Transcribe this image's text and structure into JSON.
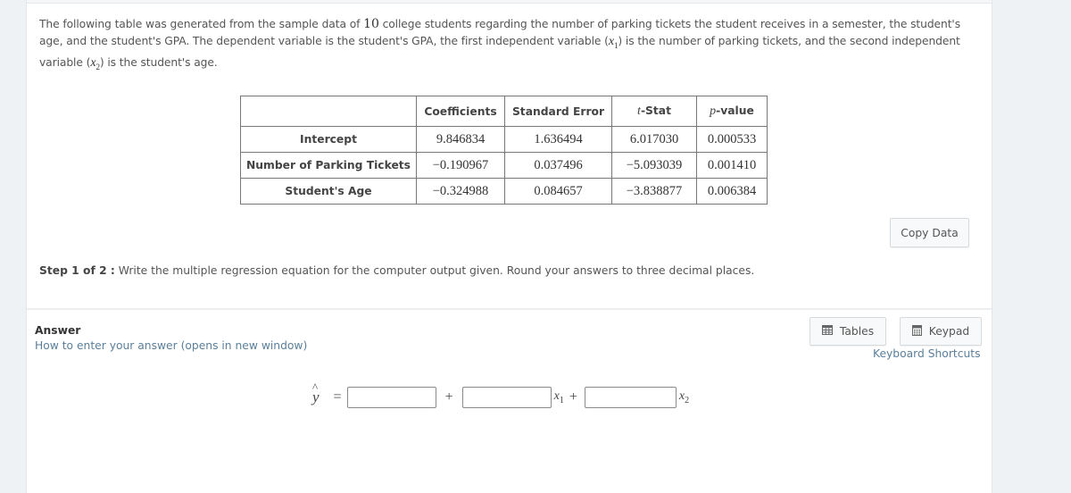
{
  "intro": {
    "part1": "The following table was generated from the sample data of ",
    "sample_size": "10",
    "part2": " college students regarding the number of parking tickets the student receives in a semester, the student's age, and the student's GPA. The dependent variable is the student's GPA, the first independent variable (",
    "x1_var": "x",
    "x1_sub": "1",
    "part3": ") is the number of parking tickets, and the second independent variable (",
    "x2_var": "x",
    "x2_sub": "2",
    "part4": ") is the student's age."
  },
  "table": {
    "headers": {
      "blank": "",
      "coefficients": "Coefficients",
      "standard_error": "Standard Error",
      "t_stat_italic": "t",
      "t_stat_rest": "-Stat",
      "p_value_italic": "p",
      "p_value_rest": "-value"
    },
    "rows": [
      {
        "label": "Intercept",
        "coefficient": "9.846834",
        "standard_error": "1.636494",
        "t_stat": "6.017030",
        "p_value": "0.000533"
      },
      {
        "label": "Number of Parking Tickets",
        "coefficient": "−0.190967",
        "standard_error": "0.037496",
        "t_stat": "−5.093039",
        "p_value": "0.001410"
      },
      {
        "label": "Student's Age",
        "coefficient": "−0.324988",
        "standard_error": "0.084657",
        "t_stat": "−3.838877",
        "p_value": "0.006384"
      }
    ]
  },
  "copy_data_button": "Copy Data",
  "step": {
    "label": "Step 1 of 2 :",
    "text": " Write the multiple regression equation for the computer output given. Round your answers to three decimal places."
  },
  "answer": {
    "label": "Answer",
    "howto_link": "How to enter your answer (opens in new window)",
    "tables_button": "Tables",
    "tables_icon": "table-grid-icon",
    "keypad_button": "Keypad",
    "keypad_icon": "calculator-icon",
    "keyboard_shortcuts_link": "Keyboard Shortcuts"
  },
  "equation": {
    "yhat": "y",
    "hat": "^",
    "equals": "=",
    "plus1": "+",
    "plus2": "+",
    "x1_var": "x",
    "x1_sub": "1",
    "x2_var": "x",
    "x2_sub": "2",
    "intercept_value": "",
    "b1_value": "",
    "b2_value": ""
  },
  "colors": {
    "page_bg": "#eef2f5",
    "panel_bg": "#ffffff",
    "link": "#5b7f9a",
    "text": "#555555"
  }
}
